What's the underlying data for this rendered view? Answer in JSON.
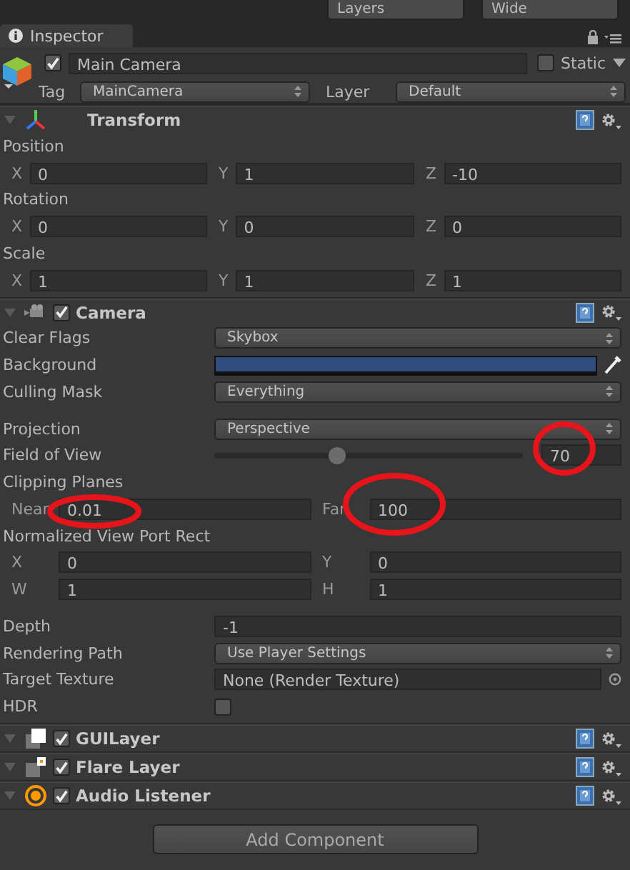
{
  "toolbar": {
    "dropdowns": [
      "Layers",
      "Wide"
    ]
  },
  "tab": {
    "label": "Inspector",
    "selected": true
  },
  "object": {
    "active": true,
    "name": "Main Camera",
    "static": false,
    "static_label": "Static",
    "tag_label": "Tag",
    "tag": "MainCamera",
    "layer_label": "Layer",
    "layer": "Default"
  },
  "components": [
    {
      "name": "Transform",
      "kind": "transform",
      "expanded": true,
      "properties": [
        {
          "kind": "label",
          "label": "Position"
        },
        {
          "kind": "vector",
          "fields": [
            {
              "axis": "X",
              "value": "0"
            },
            {
              "axis": "Y",
              "value": "1"
            },
            {
              "axis": "Z",
              "value": "-10"
            }
          ]
        },
        {
          "kind": "label",
          "label": "Rotation"
        },
        {
          "kind": "vector",
          "fields": [
            {
              "axis": "X",
              "value": "0"
            },
            {
              "axis": "Y",
              "value": "0"
            },
            {
              "axis": "Z",
              "value": "0"
            }
          ]
        },
        {
          "kind": "label",
          "label": "Scale"
        },
        {
          "kind": "vector",
          "fields": [
            {
              "axis": "X",
              "value": "1"
            },
            {
              "axis": "Y",
              "value": "1"
            },
            {
              "axis": "Z",
              "value": "1"
            }
          ]
        }
      ]
    },
    {
      "name": "Camera",
      "kind": "camera",
      "enabled": true,
      "expanded": true,
      "properties": [
        {
          "kind": "dropdown",
          "label": "Clear Flags",
          "value": "Skybox"
        },
        {
          "kind": "color",
          "label": "Background",
          "color": "#2f4c7c"
        },
        {
          "kind": "dropdown",
          "label": "Culling Mask",
          "value": "Everything"
        },
        {
          "kind": "spacer"
        },
        {
          "kind": "dropdown",
          "label": "Projection",
          "value": "Perspective"
        },
        {
          "kind": "slider",
          "label": "Field of View",
          "level": 0.4,
          "value": "70"
        },
        {
          "kind": "label",
          "label": "Clipping Planes"
        },
        {
          "kind": "vector",
          "fields": [
            {
              "axis": "Near",
              "value": "0.01"
            },
            {
              "axis": "Far",
              "value": "100"
            }
          ]
        },
        {
          "kind": "label",
          "label": "Normalized View Port Rect"
        },
        {
          "kind": "vector",
          "fields": [
            {
              "axis": "X",
              "value": "0"
            },
            {
              "axis": "Y",
              "value": "0"
            }
          ]
        },
        {
          "kind": "vector",
          "fields": [
            {
              "axis": "W",
              "value": "1"
            },
            {
              "axis": "H",
              "value": "1"
            }
          ]
        },
        {
          "kind": "spacer"
        },
        {
          "kind": "text",
          "label": "Depth",
          "value": "-1"
        },
        {
          "kind": "dropdown",
          "label": "Rendering Path",
          "value": "Use Player Settings"
        },
        {
          "kind": "object",
          "label": "Target Texture",
          "value": "None (Render Texture)"
        },
        {
          "kind": "checkbox",
          "label": "HDR",
          "checked": false
        }
      ]
    },
    {
      "name": "GUILayer",
      "kind": "guilayer",
      "enabled": true,
      "expanded": true
    },
    {
      "name": "Flare Layer",
      "kind": "flare",
      "enabled": true,
      "expanded": true
    },
    {
      "name": "Audio Listener",
      "kind": "audio",
      "enabled": true,
      "expanded": true
    }
  ],
  "add_button": "Add Component"
}
